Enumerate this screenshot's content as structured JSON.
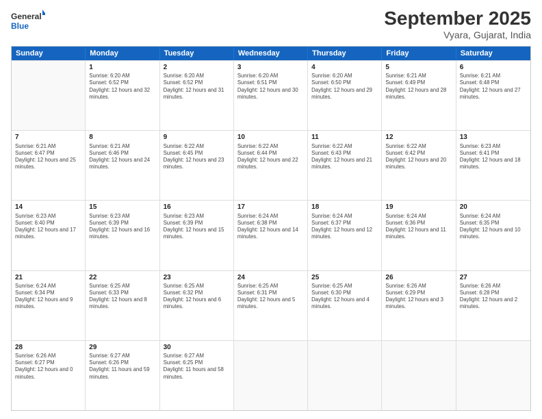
{
  "header": {
    "logo_line1": "General",
    "logo_line2": "Blue",
    "main_title": "September 2025",
    "sub_title": "Vyara, Gujarat, India"
  },
  "calendar": {
    "days_of_week": [
      "Sunday",
      "Monday",
      "Tuesday",
      "Wednesday",
      "Thursday",
      "Friday",
      "Saturday"
    ],
    "weeks": [
      [
        {
          "day": "",
          "empty": true
        },
        {
          "day": "1",
          "sunrise": "6:20 AM",
          "sunset": "6:52 PM",
          "daylight": "12 hours and 32 minutes."
        },
        {
          "day": "2",
          "sunrise": "6:20 AM",
          "sunset": "6:52 PM",
          "daylight": "12 hours and 31 minutes."
        },
        {
          "day": "3",
          "sunrise": "6:20 AM",
          "sunset": "6:51 PM",
          "daylight": "12 hours and 30 minutes."
        },
        {
          "day": "4",
          "sunrise": "6:20 AM",
          "sunset": "6:50 PM",
          "daylight": "12 hours and 29 minutes."
        },
        {
          "day": "5",
          "sunrise": "6:21 AM",
          "sunset": "6:49 PM",
          "daylight": "12 hours and 28 minutes."
        },
        {
          "day": "6",
          "sunrise": "6:21 AM",
          "sunset": "6:48 PM",
          "daylight": "12 hours and 27 minutes."
        }
      ],
      [
        {
          "day": "7",
          "sunrise": "6:21 AM",
          "sunset": "6:47 PM",
          "daylight": "12 hours and 25 minutes."
        },
        {
          "day": "8",
          "sunrise": "6:21 AM",
          "sunset": "6:46 PM",
          "daylight": "12 hours and 24 minutes."
        },
        {
          "day": "9",
          "sunrise": "6:22 AM",
          "sunset": "6:45 PM",
          "daylight": "12 hours and 23 minutes."
        },
        {
          "day": "10",
          "sunrise": "6:22 AM",
          "sunset": "6:44 PM",
          "daylight": "12 hours and 22 minutes."
        },
        {
          "day": "11",
          "sunrise": "6:22 AM",
          "sunset": "6:43 PM",
          "daylight": "12 hours and 21 minutes."
        },
        {
          "day": "12",
          "sunrise": "6:22 AM",
          "sunset": "6:42 PM",
          "daylight": "12 hours and 20 minutes."
        },
        {
          "day": "13",
          "sunrise": "6:23 AM",
          "sunset": "6:41 PM",
          "daylight": "12 hours and 18 minutes."
        }
      ],
      [
        {
          "day": "14",
          "sunrise": "6:23 AM",
          "sunset": "6:40 PM",
          "daylight": "12 hours and 17 minutes."
        },
        {
          "day": "15",
          "sunrise": "6:23 AM",
          "sunset": "6:39 PM",
          "daylight": "12 hours and 16 minutes."
        },
        {
          "day": "16",
          "sunrise": "6:23 AM",
          "sunset": "6:39 PM",
          "daylight": "12 hours and 15 minutes."
        },
        {
          "day": "17",
          "sunrise": "6:24 AM",
          "sunset": "6:38 PM",
          "daylight": "12 hours and 14 minutes."
        },
        {
          "day": "18",
          "sunrise": "6:24 AM",
          "sunset": "6:37 PM",
          "daylight": "12 hours and 12 minutes."
        },
        {
          "day": "19",
          "sunrise": "6:24 AM",
          "sunset": "6:36 PM",
          "daylight": "12 hours and 11 minutes."
        },
        {
          "day": "20",
          "sunrise": "6:24 AM",
          "sunset": "6:35 PM",
          "daylight": "12 hours and 10 minutes."
        }
      ],
      [
        {
          "day": "21",
          "sunrise": "6:24 AM",
          "sunset": "6:34 PM",
          "daylight": "12 hours and 9 minutes."
        },
        {
          "day": "22",
          "sunrise": "6:25 AM",
          "sunset": "6:33 PM",
          "daylight": "12 hours and 8 minutes."
        },
        {
          "day": "23",
          "sunrise": "6:25 AM",
          "sunset": "6:32 PM",
          "daylight": "12 hours and 6 minutes."
        },
        {
          "day": "24",
          "sunrise": "6:25 AM",
          "sunset": "6:31 PM",
          "daylight": "12 hours and 5 minutes."
        },
        {
          "day": "25",
          "sunrise": "6:25 AM",
          "sunset": "6:30 PM",
          "daylight": "12 hours and 4 minutes."
        },
        {
          "day": "26",
          "sunrise": "6:26 AM",
          "sunset": "6:29 PM",
          "daylight": "12 hours and 3 minutes."
        },
        {
          "day": "27",
          "sunrise": "6:26 AM",
          "sunset": "6:28 PM",
          "daylight": "12 hours and 2 minutes."
        }
      ],
      [
        {
          "day": "28",
          "sunrise": "6:26 AM",
          "sunset": "6:27 PM",
          "daylight": "12 hours and 0 minutes."
        },
        {
          "day": "29",
          "sunrise": "6:27 AM",
          "sunset": "6:26 PM",
          "daylight": "11 hours and 59 minutes."
        },
        {
          "day": "30",
          "sunrise": "6:27 AM",
          "sunset": "6:25 PM",
          "daylight": "11 hours and 58 minutes."
        },
        {
          "day": "",
          "empty": true
        },
        {
          "day": "",
          "empty": true
        },
        {
          "day": "",
          "empty": true
        },
        {
          "day": "",
          "empty": true
        }
      ]
    ]
  }
}
